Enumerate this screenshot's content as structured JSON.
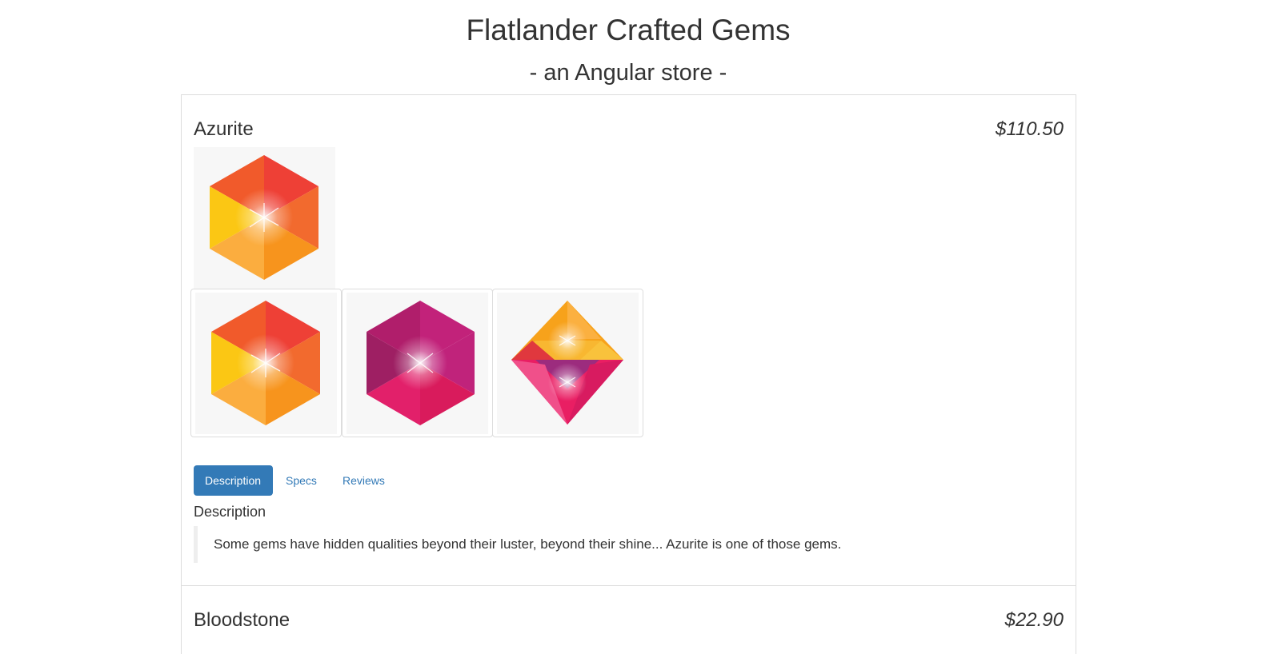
{
  "header": {
    "title": "Flatlander Crafted Gems",
    "subtitle": "- an Angular store -"
  },
  "products": [
    {
      "name": "Azurite",
      "price": "$110.50",
      "tabs": [
        {
          "label": "Description",
          "active": true
        },
        {
          "label": "Specs",
          "active": false
        },
        {
          "label": "Reviews",
          "active": false
        }
      ],
      "section_title": "Description",
      "description": "Some gems have hidden qualities beyond their luster, beyond their shine... Azurite is one of those gems.",
      "main_image_icon": "orange-hexagon-gem-icon",
      "thumbnails": [
        {
          "icon": "orange-hexagon-gem-icon"
        },
        {
          "icon": "magenta-hexagon-gem-icon"
        },
        {
          "icon": "pink-diamond-gem-icon"
        }
      ]
    },
    {
      "name": "Bloodstone",
      "price": "$22.90"
    }
  ],
  "colors": {
    "accent": "#337ab7",
    "border": "#dddddd",
    "text": "#333333"
  }
}
